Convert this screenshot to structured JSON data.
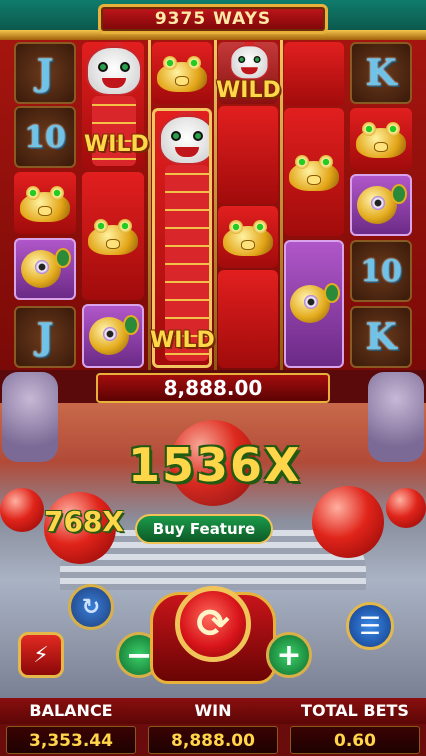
{
  "header": {
    "ways_text": "9375 WAYS"
  },
  "reels": {
    "wild_label": "WILD",
    "symbols": {
      "letter_j": "J",
      "letter_k": "K",
      "number_10": "10"
    }
  },
  "win_display": {
    "amount": "8,888.00"
  },
  "multipliers": {
    "main": "1536X",
    "side": "768X"
  },
  "buy_feature": {
    "label": "Buy Feature"
  },
  "footer": {
    "balance_label": "BALANCE",
    "balance_value": "3,353.44",
    "win_label": "WIN",
    "win_value": "8,888.00",
    "total_bets_label": "TOTAL BETS",
    "total_bets_value": "0.60"
  },
  "colors": {
    "gold": "#e8b23a",
    "red": "#c0161b",
    "green_text_outline": "#225a12"
  }
}
